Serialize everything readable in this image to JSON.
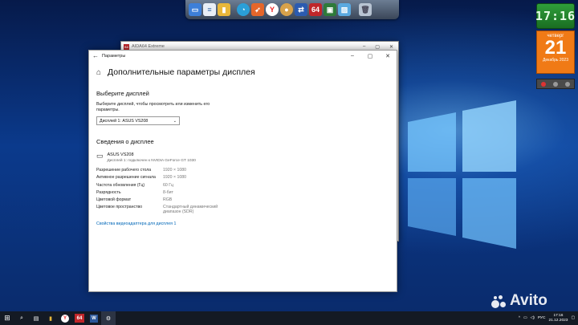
{
  "dock": {
    "icons": [
      "computer-icon",
      "document-icon",
      "folder-icon",
      "speed-icon",
      "bird-icon",
      "yandex-icon",
      "globe-icon",
      "switch-icon",
      "aida64-icon",
      "monitor-icon",
      "image-icon",
      "trash-icon"
    ],
    "aida_label": "64",
    "yandex_label": "Y"
  },
  "clock_widget": {
    "time": "17:16"
  },
  "calendar_widget": {
    "weekday": "четверг",
    "day": "21",
    "month_year": "Декабрь 2023"
  },
  "aida_window": {
    "title": "AIDA64 Extreme",
    "icon_label": "64"
  },
  "settings": {
    "window_title": "Параметры",
    "page_title": "Дополнительные параметры дисплея",
    "choose_display": {
      "heading": "Выберите дисплей",
      "description": "Выберите дисплей, чтобы просмотреть или изменить его параметры.",
      "selected": "Дисплей 1: ASUS VS208"
    },
    "info": {
      "heading": "Сведения о дисплее",
      "display_name": "ASUS VS208",
      "display_sub": "Дисплей 1: подключен к NVIDIA GeForce GT 1030",
      "rows": [
        {
          "key": "Разрешение рабочего стола",
          "value": "1920 × 1080"
        },
        {
          "key": "Активное разрешение сигнала",
          "value": "1920 × 1080"
        },
        {
          "key": "Частота обновления (Гц)",
          "value": "60 Гц"
        },
        {
          "key": "Разрядность",
          "value": "8-бит"
        },
        {
          "key": "Цветовой формат",
          "value": "RGB"
        },
        {
          "key": "Цветовое пространство",
          "value": "Стандартный динамический диапазон (SDR)"
        }
      ],
      "adapter_link": "Свойства видеоадаптера для дисплея 1"
    }
  },
  "taskbar": {
    "aida_label": "64",
    "tray_lang": "РУС",
    "tray_time": "17:16",
    "tray_date": "21.12.2023"
  },
  "watermark": {
    "text": "Avito"
  },
  "colors": {
    "accent_link": "#0067b8",
    "calendar": "#f07a16",
    "clock": "#2f9e3a",
    "aida_red": "#c0262a"
  }
}
